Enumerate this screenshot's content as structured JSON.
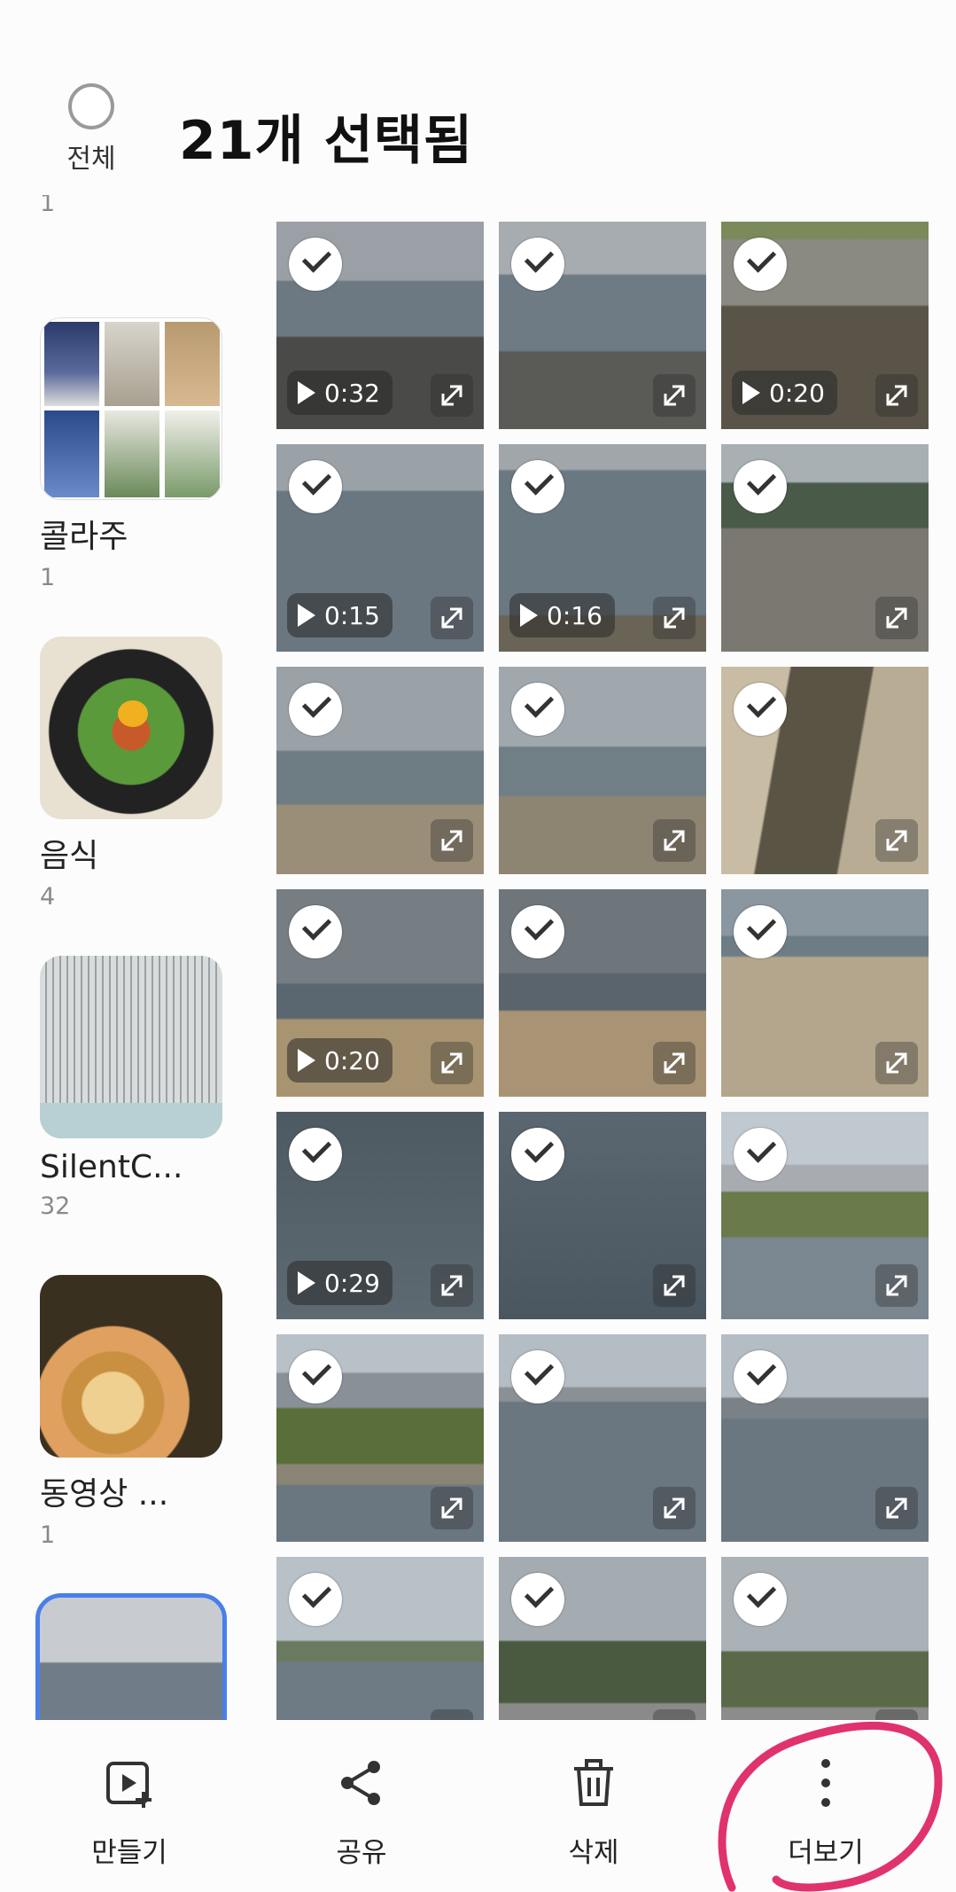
{
  "header": {
    "select_all_label": "전체",
    "title": "21개 선택됨"
  },
  "sidebar": {
    "albums": [
      {
        "name": "",
        "count": "1",
        "thumb": "partial-album"
      },
      {
        "name": "콜라주",
        "count": "1",
        "thumb": "collage"
      },
      {
        "name": "음식",
        "count": "4",
        "thumb": "food-bowl"
      },
      {
        "name": "SilentC...",
        "count": "32",
        "thumb": "document-page"
      },
      {
        "name": "동영상 ...",
        "count": "1",
        "thumb": "bibimbap"
      },
      {
        "name": "",
        "count": "",
        "thumb": "sea-rocks",
        "selected": true
      }
    ]
  },
  "grid": {
    "tiles": [
      {
        "scene": "sea-rocks",
        "checked": true,
        "video": true,
        "duration": "0:32"
      },
      {
        "scene": "sea-rocks-2",
        "checked": true,
        "video": false,
        "duration": ""
      },
      {
        "scene": "rocky-shore",
        "checked": true,
        "video": true,
        "duration": "0:20"
      },
      {
        "scene": "sea-calm",
        "checked": true,
        "video": true,
        "duration": "0:15"
      },
      {
        "scene": "sea-buoy",
        "checked": true,
        "video": true,
        "duration": "0:16"
      },
      {
        "scene": "coast-buildings",
        "checked": true,
        "video": false,
        "duration": ""
      },
      {
        "scene": "beach-rocks",
        "checked": true,
        "video": false,
        "duration": ""
      },
      {
        "scene": "beach-rocks-2",
        "checked": true,
        "video": false,
        "duration": ""
      },
      {
        "scene": "stream-sand",
        "checked": true,
        "video": false,
        "duration": ""
      },
      {
        "scene": "beach-people",
        "checked": true,
        "video": true,
        "duration": "0:20"
      },
      {
        "scene": "dolphin-statue",
        "checked": true,
        "video": false,
        "duration": ""
      },
      {
        "scene": "dolphin-statue-2",
        "checked": true,
        "video": false,
        "duration": ""
      },
      {
        "scene": "water-birds",
        "checked": true,
        "video": true,
        "duration": "0:29"
      },
      {
        "scene": "water-post",
        "checked": true,
        "video": false,
        "duration": ""
      },
      {
        "scene": "city-reeds",
        "checked": true,
        "video": false,
        "duration": ""
      },
      {
        "scene": "reeds-city",
        "checked": true,
        "video": false,
        "duration": ""
      },
      {
        "scene": "lake-city",
        "checked": true,
        "video": false,
        "duration": ""
      },
      {
        "scene": "lake-city-2",
        "checked": true,
        "video": false,
        "duration": ""
      },
      {
        "scene": "lake-city-3",
        "checked": true,
        "video": false,
        "duration": ""
      },
      {
        "scene": "sculpture-fountain",
        "checked": true,
        "video": false,
        "duration": ""
      },
      {
        "scene": "sculpture-fountain-2",
        "checked": true,
        "video": false,
        "duration": ""
      }
    ]
  },
  "bottom_bar": {
    "actions": [
      {
        "label": "만들기",
        "icon": "create-icon"
      },
      {
        "label": "공유",
        "icon": "share-icon"
      },
      {
        "label": "삭제",
        "icon": "delete-icon"
      },
      {
        "label": "더보기",
        "icon": "more-icon"
      }
    ]
  },
  "colors": {
    "selected_album_outline": "#4a7fe8",
    "annotation": "#e0326e"
  }
}
